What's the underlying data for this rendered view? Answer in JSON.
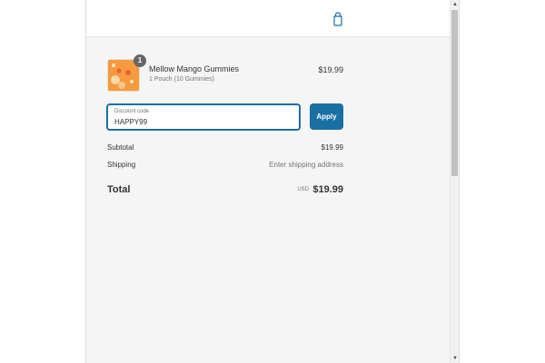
{
  "header": {
    "cart_icon": "shopping-bag-icon",
    "accent_color": "#1a6fa3"
  },
  "order": {
    "item": {
      "name": "Mellow Mango Gummies",
      "variant": "1 Pouch (10 Gummies)",
      "price": "$19.99",
      "quantity": "1",
      "image_icon": "product-thumbnail"
    },
    "discount": {
      "label": "Discount code",
      "value": "HAPPY99",
      "apply_label": "Apply"
    },
    "summary": {
      "subtotal_label": "Subtotal",
      "subtotal_value": "$19.99",
      "shipping_label": "Shipping",
      "shipping_value": "Enter shipping address",
      "total_label": "Total",
      "currency": "USD",
      "total_value": "$19.99"
    }
  },
  "scrollbar": {
    "up_icon": "scroll-up-arrow-icon",
    "down_icon": "scroll-down-arrow-icon"
  }
}
